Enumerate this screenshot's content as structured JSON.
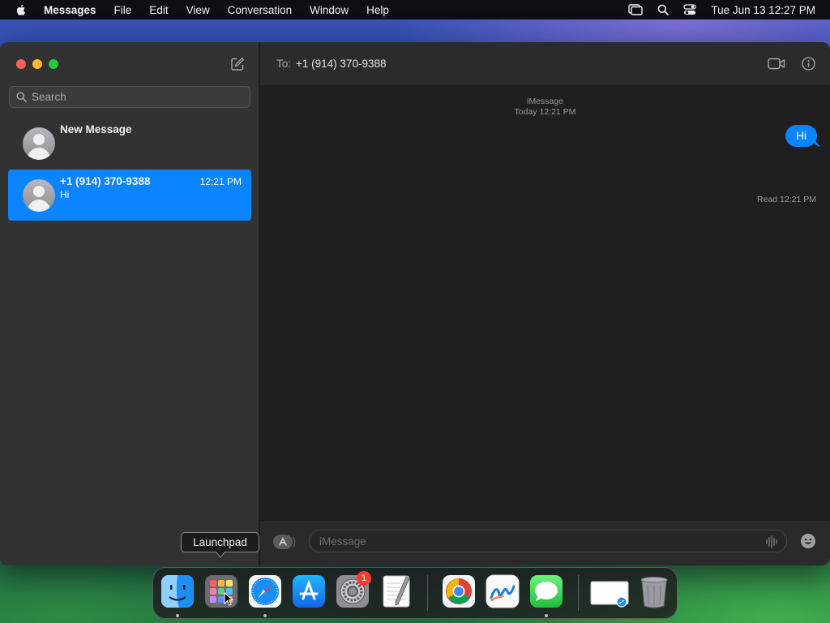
{
  "menubar": {
    "app_name": "Messages",
    "items": [
      "File",
      "Edit",
      "View",
      "Conversation",
      "Window",
      "Help"
    ],
    "clock": "Tue Jun 13  12:27 PM",
    "status_icons": [
      "screen-mirroring-icon",
      "spotlight-icon",
      "control-center-icon"
    ]
  },
  "sidebar": {
    "search_placeholder": "Search",
    "conversations": [
      {
        "name": "New Message",
        "time": "",
        "preview": ""
      },
      {
        "name": "+1 (914) 370-9388",
        "time": "12:21 PM",
        "preview": "Hi",
        "selected": true
      }
    ]
  },
  "header": {
    "to_label": "To:",
    "recipient": "+1 (914) 370-9388"
  },
  "transcript": {
    "service": "iMessage",
    "service_time": "Today 12:21 PM",
    "messages": [
      {
        "text": "Hi",
        "from_me": true
      }
    ],
    "read_receipt": "Read 12:21 PM"
  },
  "composer": {
    "placeholder": "iMessage"
  },
  "tooltip": {
    "text": "Launchpad"
  },
  "dock": {
    "items": [
      "Finder",
      "Launchpad",
      "Safari",
      "App Store",
      "System Settings",
      "TextEdit",
      "Google Chrome",
      "Freeform",
      "Messages",
      "Preview",
      "Trash"
    ],
    "settings_badge": "1"
  },
  "colors": {
    "accent": "#0a84ff",
    "sidebar_bg": "#323232",
    "transcript_bg": "#1f1f1f"
  }
}
